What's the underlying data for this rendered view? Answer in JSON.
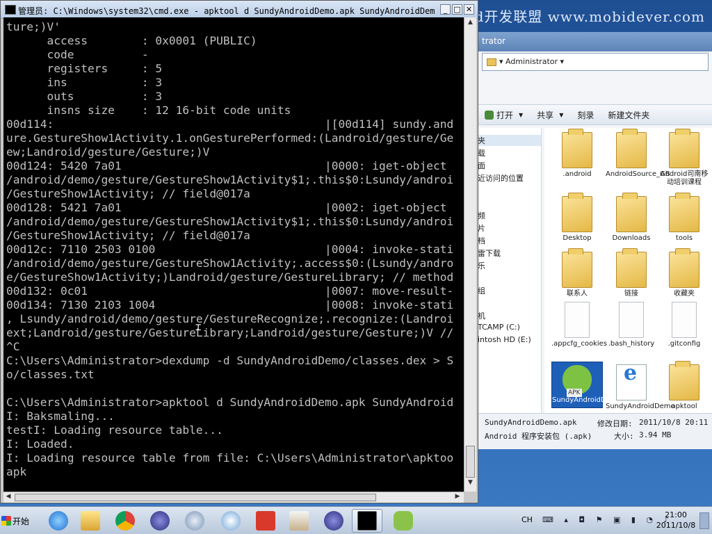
{
  "watermark": "Android开发联盟 www.mobidever.com",
  "cmd": {
    "title": "管理员: C:\\Windows\\system32\\cmd.exe - apktool  d SundyAndroidDemo.apk SundyAndroidDemo",
    "lines": [
      "ture;)V'",
      "      access        : 0x0001 (PUBLIC)",
      "      code          -",
      "      registers     : 5",
      "      ins           : 3",
      "      outs          : 3",
      "      insns size    : 12 16-bit code units",
      "00d114:                                        |[00d114] sundy.and",
      "ure.GestureShow1Activity.1.onGesturePerformed:(Landroid/gesture/Ge",
      "ew;Landroid/gesture/Gesture;)V",
      "00d124: 5420 7a01                              |0000: iget-object",
      "/android/demo/gesture/GestureShow1Activity$1;.this$0:Lsundy/androi",
      "/GestureShow1Activity; // field@017a",
      "00d128: 5421 7a01                              |0002: iget-object",
      "/android/demo/gesture/GestureShow1Activity$1;.this$0:Lsundy/androi",
      "/GestureShow1Activity; // field@017a",
      "00d12c: 7110 2503 0100                         |0004: invoke-stati",
      "/android/demo/gesture/GestureShow1Activity;.access$0:(Lsundy/andro",
      "e/GestureShow1Activity;)Landroid/gesture/GestureLibrary; // method",
      "00d132: 0c01                                   |0007: move-result-",
      "00d134: 7130 2103 1004                         |0008: invoke-stati",
      ", Lsundy/android/demo/gesture/GestureRecognize;.recognize:(Landroi",
      "ext;Landroid/gesture/GestureLibrary;Landroid/gesture/Gesture;)V //",
      "^C",
      "C:\\Users\\Administrator>dexdump -d SundyAndroidDemo/classes.dex > S",
      "o/classes.txt",
      "",
      "C:\\Users\\Administrator>apktool d SundyAndroidDemo.apk SundyAndroid",
      "I: Baksmaling...",
      "testI: Loading resource table...",
      "I: Loaded.",
      "I: Loading resource table from file: C:\\Users\\Administrator\\apktoo",
      "apk"
    ]
  },
  "explorer": {
    "title": "trator",
    "address": "▾ Administrator ▾",
    "toolbar": {
      "open": "打开",
      "share": "共享",
      "burn": "刻录",
      "new_folder": "新建文件夹"
    },
    "nav": [
      "夹",
      "载",
      "面",
      "近访问的位置",
      "频",
      "片",
      "档",
      "雷下载",
      "乐",
      "组",
      "机",
      "TCAMP (C:)",
      "intosh HD (E:)"
    ],
    "files": [
      {
        "label": ".android",
        "type": "folder"
      },
      {
        "label": "AndroidSource_GB",
        "type": "folder"
      },
      {
        "label": "Android司南移动培训课程",
        "type": "folder"
      },
      {
        "label": "Desktop",
        "type": "folder"
      },
      {
        "label": "Downloads",
        "type": "folder"
      },
      {
        "label": "tools",
        "type": "folder"
      },
      {
        "label": "联系人",
        "type": "folder"
      },
      {
        "label": "链接",
        "type": "folder"
      },
      {
        "label": "收藏夹",
        "type": "folder"
      },
      {
        "label": ".appcfg_cookies",
        "type": "doc"
      },
      {
        "label": ".bash_history",
        "type": "doc"
      },
      {
        "label": ".gitconfig",
        "type": "doc"
      },
      {
        "label": "SundyAndroidDemo.apk",
        "type": "apk"
      },
      {
        "label": "SundyAndroidDemo",
        "type": "ie"
      },
      {
        "label": "apktool",
        "type": "folder"
      }
    ],
    "details": {
      "name": "SundyAndroidDemo.apk",
      "modified_label": "修改日期:",
      "modified_value": "2011/10/8 20:11",
      "type": "Android 程序安装包 (.apk)",
      "size_label": "大小:",
      "size_value": "3.94 MB"
    }
  },
  "taskbar": {
    "start_label": "开始",
    "lang": "CH",
    "time": "21:00",
    "date": "2011/10/8",
    "apps": [
      "ie-icon",
      "explorer-icon",
      "chrome-icon",
      "eclipse-icon",
      "magnifier-icon",
      "satellite-icon",
      "mail-icon",
      "java-icon",
      "eclipse2-icon",
      "cmd-icon",
      "android-icon"
    ]
  }
}
